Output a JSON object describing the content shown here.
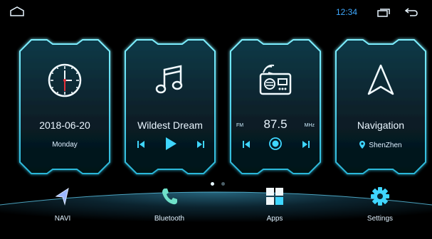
{
  "status_bar": {
    "time": "12:34",
    "icons": [
      "home-icon",
      "recents-icon",
      "back-icon"
    ],
    "time_color": "#3fa9ff"
  },
  "cards": {
    "clock": {
      "date": "2018-06-20",
      "weekday": "Monday",
      "icon": "clock-icon"
    },
    "music": {
      "track": "Wildest Dream",
      "icon": "music-note-icon",
      "controls": [
        "previous-icon",
        "play-icon",
        "next-icon"
      ]
    },
    "radio": {
      "band": "FM",
      "frequency": "87.5",
      "unit": "MHz",
      "icon": "radio-icon",
      "controls": [
        "previous-icon",
        "record-icon",
        "next-icon"
      ]
    },
    "navigation": {
      "title": "Navigation",
      "location": "ShenZhen",
      "icon": "navigation-arrow-icon"
    }
  },
  "pager": {
    "pages": 2,
    "active": 1
  },
  "dock": {
    "items": [
      {
        "label": "NAVI",
        "icon": "navi-icon"
      },
      {
        "label": "Bluetooth",
        "icon": "phone-icon"
      },
      {
        "label": "Apps",
        "icon": "apps-grid-icon"
      },
      {
        "label": "Settings",
        "icon": "gear-icon"
      }
    ]
  },
  "colors": {
    "accent": "#3fd6ff",
    "background": "#000000",
    "glow": "#1aa7c8"
  }
}
